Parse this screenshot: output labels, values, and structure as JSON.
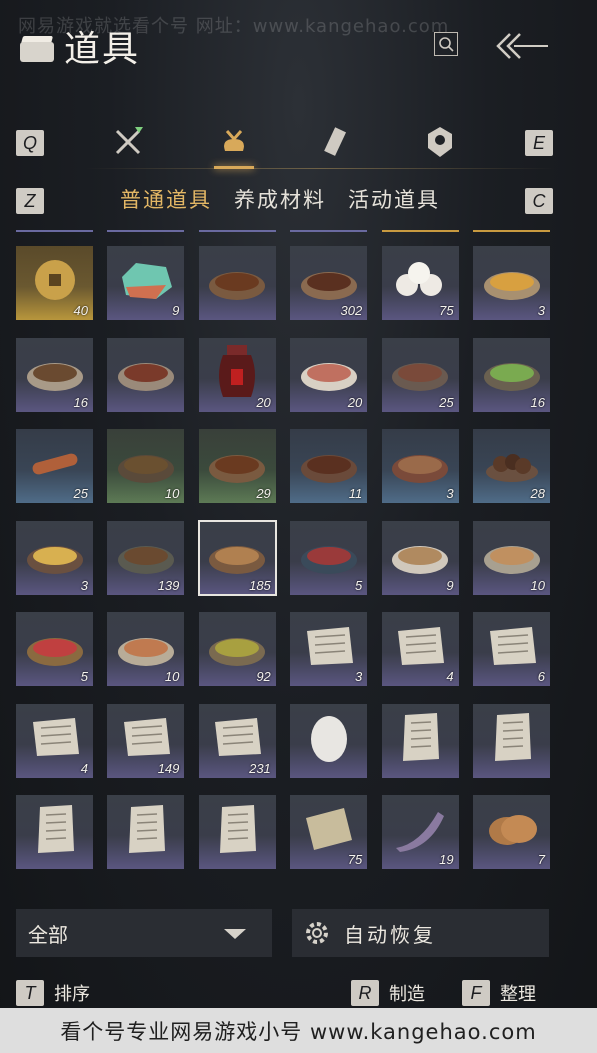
{
  "watermark": "网易游戏就选看个号   网址：www.kangehao.com",
  "header": {
    "title": "道具"
  },
  "tabs": {
    "prev_key": "Q",
    "next_key": "E",
    "icons": [
      "crossed-swords-icon",
      "pouch-icon",
      "scroll-icon",
      "badge-icon"
    ],
    "active_index": 1,
    "accent": "#d8a95a"
  },
  "subtabs": {
    "prev_key": "Z",
    "next_key": "C",
    "items": [
      "普通道具",
      "养成材料",
      "活动道具"
    ],
    "active_index": 0
  },
  "inventory": {
    "items": [
      {
        "icon": "coin-icon",
        "count": "40",
        "rarity": "gold"
      },
      {
        "icon": "jade-stone-icon",
        "count": "9",
        "rarity": "purple"
      },
      {
        "icon": "stew-pot-icon",
        "count": "",
        "rarity": "purple"
      },
      {
        "icon": "clay-pot-icon",
        "count": "302",
        "rarity": "purple"
      },
      {
        "icon": "buns-icon",
        "count": "75",
        "rarity": "purple"
      },
      {
        "icon": "soup-bowl-icon",
        "count": "3",
        "rarity": "purple"
      },
      {
        "icon": "noodle-bowl-icon",
        "count": "16",
        "rarity": "purple"
      },
      {
        "icon": "meat-bowl-icon",
        "count": "",
        "rarity": "purple"
      },
      {
        "icon": "wine-jar-icon",
        "count": "20",
        "rarity": "purple"
      },
      {
        "icon": "egg-plate-icon",
        "count": "20",
        "rarity": "purple"
      },
      {
        "icon": "sliced-meat-icon",
        "count": "25",
        "rarity": "purple"
      },
      {
        "icon": "okra-plate-icon",
        "count": "16",
        "rarity": "purple"
      },
      {
        "icon": "sausage-icon",
        "count": "25",
        "rarity": "blue"
      },
      {
        "icon": "mushroom-bowl-icon",
        "count": "10",
        "rarity": "green"
      },
      {
        "icon": "stew-pot-icon",
        "count": "29",
        "rarity": "green"
      },
      {
        "icon": "braised-bowl-icon",
        "count": "11",
        "rarity": "blue"
      },
      {
        "icon": "dumpling-stand-icon",
        "count": "3",
        "rarity": "blue"
      },
      {
        "icon": "meatballs-icon",
        "count": "28",
        "rarity": "blue"
      },
      {
        "icon": "dessert-tray-icon",
        "count": "3",
        "rarity": "purple"
      },
      {
        "icon": "stone-pot-icon",
        "count": "139",
        "rarity": "purple"
      },
      {
        "icon": "pastry-bowl-icon",
        "count": "185",
        "rarity": "purple",
        "selected": true
      },
      {
        "icon": "steak-plate-icon",
        "count": "5",
        "rarity": "purple"
      },
      {
        "icon": "flatbread-icon",
        "count": "9",
        "rarity": "purple"
      },
      {
        "icon": "noodle-plate-icon",
        "count": "10",
        "rarity": "purple"
      },
      {
        "icon": "cake-icon",
        "count": "5",
        "rarity": "purple"
      },
      {
        "icon": "pancake-icon",
        "count": "10",
        "rarity": "purple"
      },
      {
        "icon": "veggie-bowl-icon",
        "count": "92",
        "rarity": "purple"
      },
      {
        "icon": "recipe-paper-icon",
        "count": "3",
        "rarity": "purple"
      },
      {
        "icon": "recipe-paper-icon",
        "count": "4",
        "rarity": "purple"
      },
      {
        "icon": "recipe-paper-icon",
        "count": "6",
        "rarity": "purple"
      },
      {
        "icon": "recipe-paper-icon",
        "count": "4",
        "rarity": "purple"
      },
      {
        "icon": "recipe-paper-icon",
        "count": "149",
        "rarity": "purple"
      },
      {
        "icon": "recipe-paper-icon",
        "count": "231",
        "rarity": "purple"
      },
      {
        "icon": "egg-icon",
        "count": "",
        "rarity": "purple"
      },
      {
        "icon": "letter-icon",
        "count": "",
        "rarity": "purple"
      },
      {
        "icon": "letter-icon",
        "count": "",
        "rarity": "purple"
      },
      {
        "icon": "letter-icon",
        "count": "",
        "rarity": "purple"
      },
      {
        "icon": "letter-icon",
        "count": "",
        "rarity": "purple"
      },
      {
        "icon": "letter-icon",
        "count": "",
        "rarity": "purple"
      },
      {
        "icon": "scroll-map-icon",
        "count": "75",
        "rarity": "purple"
      },
      {
        "icon": "horn-icon",
        "count": "19",
        "rarity": "purple"
      },
      {
        "icon": "baked-bread-icon",
        "count": "7",
        "rarity": "purple"
      }
    ]
  },
  "bottom": {
    "filter_value": "全部",
    "auto_restore_label": "自动恢复"
  },
  "hints": [
    {
      "key": "T",
      "label": "排序"
    },
    {
      "key": "R",
      "label": "制造"
    },
    {
      "key": "F",
      "label": "整理"
    }
  ],
  "footer": {
    "text": "看个号专业网易游戏小号 www.kangehao.com"
  }
}
